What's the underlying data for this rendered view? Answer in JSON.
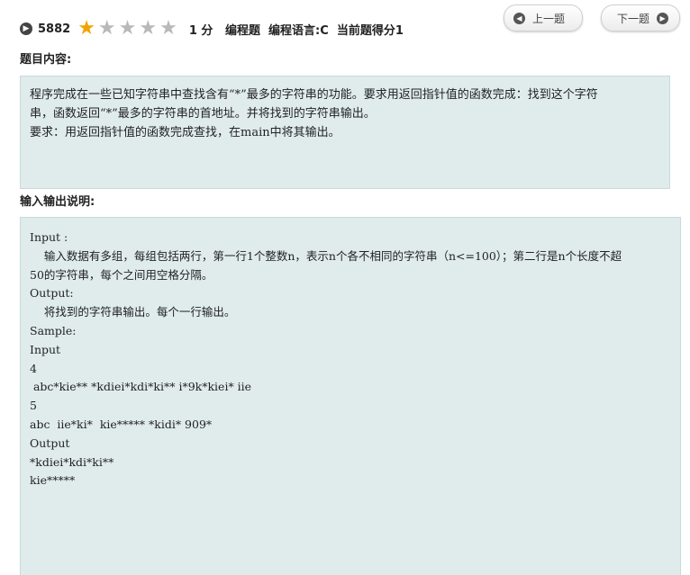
{
  "problem": {
    "id": "5882",
    "rating": {
      "filled": 1,
      "total": 5
    },
    "meta": "1 分   编程题  编程语言:C  当前题得分1"
  },
  "nav": {
    "prev_label": "上一题",
    "next_label": "下一题"
  },
  "sections": {
    "content_title": "题目内容:",
    "io_title": "输入输出说明:"
  },
  "content": {
    "lines": [
      "程序完成在一些已知字符串中查找含有“*”最多的字符串的功能。要求用返回指针值的函数完成：找到这个字符",
      "串，函数返回“*”最多的字符串的首地址。并将找到的字符串输出。",
      "要求：用返回指针值的函数完成查找，在main中将其输出。"
    ]
  },
  "io": {
    "lines": [
      "Input :",
      "    输入数据有多组，每组包括两行，第一行1个整数n，表示n个各不相同的字符串（n<=100）；第二行是n个长度不超",
      "50的字符串，每个之间用空格分隔。",
      "",
      "Output:",
      "    将找到的字符串输出。每个一行输出。",
      "Sample:",
      "Input",
      "",
      "4",
      " abc*kie** *kdiei*kdi*ki** i*9k*kiei* iie",
      "5",
      "abc  iie*ki*  kie***** *kidi* 909*",
      "",
      "",
      "Output",
      "*kdiei*kdi*ki**",
      "kie*****"
    ]
  },
  "colors": {
    "box_bg": "#e0ecec",
    "star_on": "#f2a300",
    "star_off": "#b9b9b9"
  },
  "icons": {
    "header": "chevron-right-circle-icon",
    "prev": "chevron-left-circle-icon",
    "next": "chevron-right-circle-icon",
    "star": "star-icon"
  }
}
